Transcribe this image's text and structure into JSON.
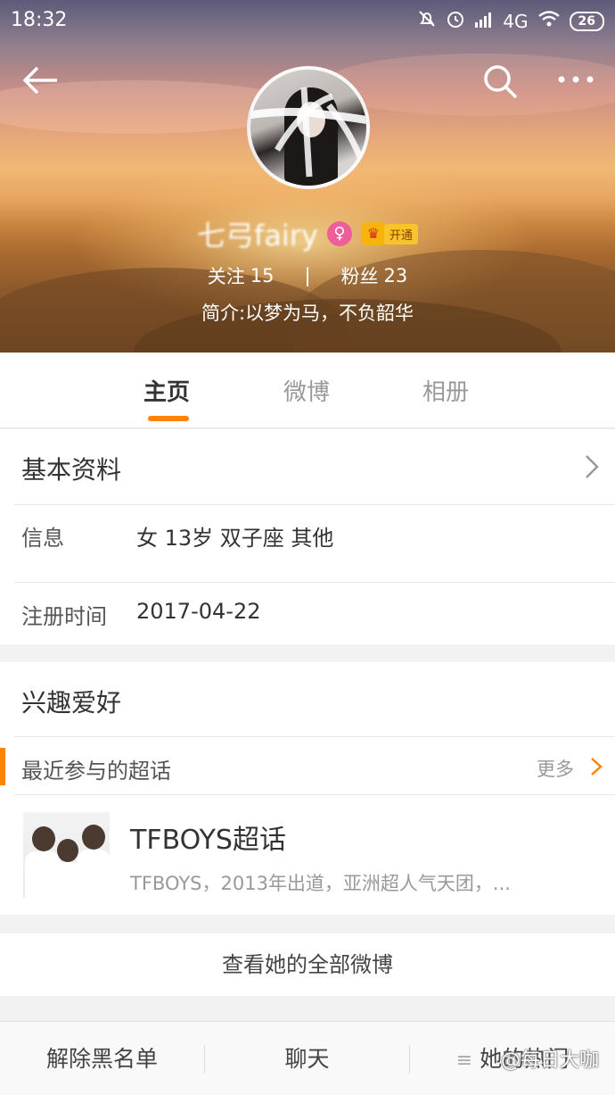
{
  "status_bar": {
    "time": "18:32",
    "network": "4G",
    "battery": "26"
  },
  "profile": {
    "nickname": "七弓fairy",
    "gender_symbol": "♀",
    "vip_open_label": "开通",
    "follow_label": "关注",
    "follow_count": "15",
    "separator": "|",
    "fans_label": "粉丝",
    "fans_count": "23",
    "bio": "简介:以梦为马，不负韶华"
  },
  "tabs": [
    {
      "label": "主页",
      "active": true
    },
    {
      "label": "微博",
      "active": false
    },
    {
      "label": "相册",
      "active": false
    }
  ],
  "basic_info": {
    "title": "基本资料",
    "info_label": "信息",
    "info_value": "女  13岁  双子座  其他",
    "reg_label": "注册时间",
    "reg_value": "2017-04-22"
  },
  "interests": {
    "title": "兴趣爱好",
    "recent_title": "最近参与的超话",
    "more_label": "更多",
    "topic_name": "TFBOYS超话",
    "topic_desc": "TFBOYS，2013年出道，亚洲超人气天团，..."
  },
  "view_all": "查看她的全部微博",
  "bottom_bar": {
    "unblock": "解除黑名单",
    "chat": "聊天",
    "hot": "她的热门"
  },
  "watermark": "@每日大咖",
  "colors": {
    "accent": "#ff8200",
    "gender_badge": "#ee5f9a",
    "vip_gold": "#f6b40d"
  }
}
